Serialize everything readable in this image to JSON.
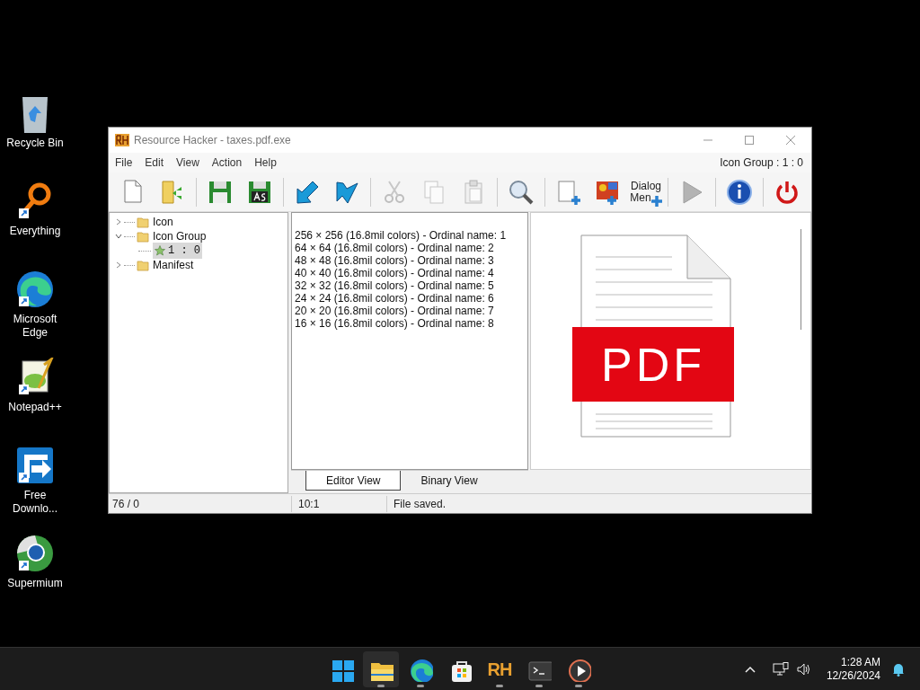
{
  "desktop_icons": [
    {
      "kind": "recycle",
      "label": "Recycle Bin",
      "shortcut": false
    },
    {
      "kind": "everything",
      "label": "Everything",
      "shortcut": true
    },
    {
      "kind": "edge",
      "label": "Microsoft Edge",
      "shortcut": true
    },
    {
      "kind": "notepad",
      "label": "Notepad++",
      "shortcut": true
    },
    {
      "kind": "download",
      "label": "Free Downlo...",
      "shortcut": true
    },
    {
      "kind": "supermium",
      "label": "Supermium",
      "shortcut": true
    }
  ],
  "window": {
    "title": "Resource Hacker - taxes.pdf.exe",
    "menu": [
      "File",
      "Edit",
      "View",
      "Action",
      "Help"
    ],
    "resource_path": "Icon Group : 1 : 0",
    "toolbar": [
      [
        {
          "kind": "new",
          "disabled": false
        },
        {
          "kind": "open",
          "disabled": false
        }
      ],
      [
        {
          "kind": "save",
          "disabled": false
        },
        {
          "kind": "saveas",
          "disabled": false
        }
      ],
      [
        {
          "kind": "compile",
          "disabled": false
        },
        {
          "kind": "export",
          "disabled": false
        }
      ],
      [
        {
          "kind": "cut",
          "disabled": true
        },
        {
          "kind": "copy",
          "disabled": true
        },
        {
          "kind": "paste",
          "disabled": true
        }
      ],
      [
        {
          "kind": "search",
          "disabled": false
        }
      ],
      [
        {
          "kind": "addblank",
          "disabled": false
        },
        {
          "kind": "addimage",
          "disabled": false
        },
        {
          "kind": "dialog",
          "disabled": false,
          "label": "Dialog",
          "label2": "Men"
        }
      ],
      [
        {
          "kind": "play",
          "disabled": true
        }
      ],
      [
        {
          "kind": "info",
          "disabled": false
        }
      ],
      [
        {
          "kind": "power",
          "disabled": false
        }
      ]
    ],
    "tree": [
      {
        "label": "Icon",
        "expanded": false
      },
      {
        "label": "Icon Group",
        "expanded": true,
        "children": [
          {
            "label": "1 : 0",
            "selected": true
          }
        ]
      },
      {
        "label": "Manifest",
        "expanded": false
      }
    ],
    "editor_lines": [
      "256 × 256 (16.8mil colors) - Ordinal name: 1",
      "64 × 64 (16.8mil colors) - Ordinal name: 2",
      "48 × 48 (16.8mil colors) - Ordinal name: 3",
      "40 × 40 (16.8mil colors) - Ordinal name: 4",
      "32 × 32 (16.8mil colors) - Ordinal name: 5",
      "24 × 24 (16.8mil colors) - Ordinal name: 6",
      "20 × 20 (16.8mil colors) - Ordinal name: 7",
      "16 × 16 (16.8mil colors) - Ordinal name: 8"
    ],
    "preview": {
      "banner": "PDF"
    },
    "tabs": [
      {
        "label": "Editor View",
        "selected": true
      },
      {
        "label": "Binary View",
        "selected": false
      }
    ],
    "status_bar": [
      "76 / 0",
      "10:1",
      "File saved."
    ]
  },
  "taskbar": {
    "items": [
      {
        "kind": "start",
        "active": false,
        "running": false
      },
      {
        "kind": "explorer",
        "active": true,
        "running": true
      },
      {
        "kind": "edge",
        "active": false,
        "running": true
      },
      {
        "kind": "store",
        "active": false,
        "running": false
      },
      {
        "kind": "rh",
        "active": false,
        "running": true,
        "label": "RH"
      },
      {
        "kind": "terminal",
        "active": false,
        "running": true
      },
      {
        "kind": "player",
        "active": false,
        "running": true
      }
    ],
    "time": "1:28 AM",
    "date": "12/26/2024"
  }
}
